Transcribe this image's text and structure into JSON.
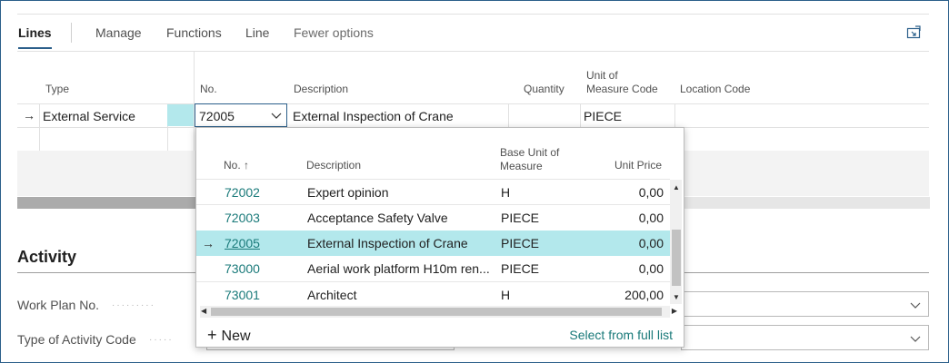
{
  "actions": {
    "lines": "Lines",
    "manage": "Manage",
    "functions": "Functions",
    "line": "Line",
    "fewer_options": "Fewer options"
  },
  "grid": {
    "headers": {
      "type": "Type",
      "no": "No.",
      "description": "Description",
      "quantity": "Quantity",
      "uom_line1": "Unit of",
      "uom_line2": "Measure Code",
      "location": "Location Code"
    },
    "row": {
      "type": "External Service",
      "no": "72005",
      "description": "External Inspection of Crane",
      "uom": "PIECE"
    }
  },
  "activity": {
    "title": "Activity",
    "work_plan_label": "Work Plan No.",
    "type_activity_label": "Type of Activity Code"
  },
  "dropdown": {
    "headers": {
      "no": "No. ↑",
      "description": "Description",
      "base_uom_line1": "Base Unit of",
      "base_uom_line2": "Measure",
      "unit_price": "Unit Price"
    },
    "rows": [
      {
        "no": "72002",
        "description": "Expert opinion",
        "uom": "H",
        "price": "0,00"
      },
      {
        "no": "72003",
        "description": "Acceptance Safety Valve",
        "uom": "PIECE",
        "price": "0,00"
      },
      {
        "no": "72005",
        "description": "External Inspection of Crane",
        "uom": "PIECE",
        "price": "0,00"
      },
      {
        "no": "73000",
        "description": "Aerial work platform H10m ren...",
        "uom": "PIECE",
        "price": "0,00"
      },
      {
        "no": "73001",
        "description": "Architect",
        "uom": "H",
        "price": "200,00"
      }
    ],
    "new_label": "New",
    "select_full_list": "Select from full list"
  },
  "colors": {
    "accent": "#2b5f8a",
    "selection": "#b3e8ec",
    "link": "#1a7a7a"
  }
}
